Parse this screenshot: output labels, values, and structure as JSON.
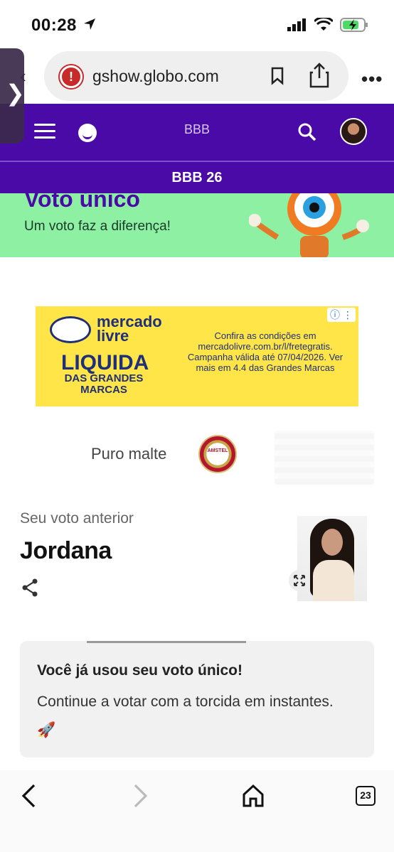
{
  "status": {
    "time": "00:28"
  },
  "browser": {
    "url": "gshow.globo.com"
  },
  "header": {
    "title": "BBB",
    "section": "BBB 26"
  },
  "banner": {
    "heading": "Voto único",
    "subtitle": "Um voto faz a diferença!"
  },
  "ad": {
    "brand_line1": "mercado",
    "brand_line2": "livre",
    "headline": "LIQUIDA",
    "headline2_line1": "DAS GRANDES",
    "headline2_line2": "MARCAS",
    "copy": "Confira as condições em mercadolivre.com.br/l/fretegratis. Campanha válida até 07/04/2026. Ver mais em 4.4 das Grandes Marcas"
  },
  "sponsor": {
    "text": "Puro malte",
    "badge_text": "AMSTEL"
  },
  "previous_vote": {
    "label": "Seu voto anterior",
    "name": "Jordana"
  },
  "notice": {
    "title": "Você já usou seu voto único!",
    "message": "Continue a votar com a torcida em instantes. 🚀"
  },
  "toolbar": {
    "tab_count": "23"
  },
  "colors": {
    "primary": "#4a0aa8",
    "banner_bg": "#8df0a3",
    "ad_bg": "#ffe548"
  }
}
